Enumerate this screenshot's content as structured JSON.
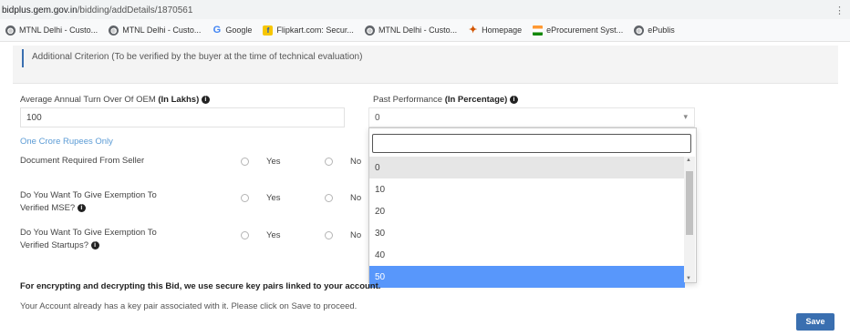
{
  "browser": {
    "url_host": "bidplus.gem.gov.in",
    "url_path": "/bidding/addDetails/1870561",
    "bookmarks": [
      {
        "label": "MTNL Delhi - Custo...",
        "icon": "globe-icon"
      },
      {
        "label": "MTNL Delhi - Custo...",
        "icon": "globe-icon"
      },
      {
        "label": "Google",
        "icon": "google-icon"
      },
      {
        "label": "Flipkart.com: Secur...",
        "icon": "flipkart-icon"
      },
      {
        "label": "MTNL Delhi - Custo...",
        "icon": "globe-icon"
      },
      {
        "label": "Homepage",
        "icon": "homepage-icon"
      },
      {
        "label": "eProcurement Syst...",
        "icon": "india-flag-icon"
      },
      {
        "label": "ePublis",
        "icon": "globe-icon"
      }
    ]
  },
  "criterion_text": "Additional Criterion (To be verified by the buyer at the time of technical evaluation)",
  "turnover": {
    "label": "Average Annual Turn Over Of OEM",
    "label_bold": "(In Lakhs)",
    "value": "100",
    "hint": "One Crore Rupees Only"
  },
  "past_performance": {
    "label": "Past Performance",
    "label_bold": "(In Percentage)",
    "selected": "0",
    "options": [
      "0",
      "10",
      "20",
      "30",
      "40",
      "50"
    ],
    "highlighted_option": "0",
    "hover_option": "50"
  },
  "questions": [
    {
      "label_line1": "Document Required From Seller",
      "label_line2": "",
      "info": false,
      "yes": "Yes",
      "no": "No"
    },
    {
      "label_line1": "Do You Want To Give Exemption To",
      "label_line2": "Verified MSE?",
      "info": true,
      "yes": "Yes",
      "no": "No"
    },
    {
      "label_line1": "Do You Want To Give Exemption To",
      "label_line2": "Verified Startups?",
      "info": true,
      "yes": "Yes",
      "no": "No"
    }
  ],
  "encryption_note": "For encrypting and decrypting this Bid, we use secure key pairs linked to your account.",
  "account_note": "Your Account already has a key pair associated with it. Please click on Save to proceed.",
  "save_label": "Save",
  "colors": {
    "accent": "#3a6fb0",
    "highlight": "#5897fb",
    "hint": "#5b9bd5"
  }
}
